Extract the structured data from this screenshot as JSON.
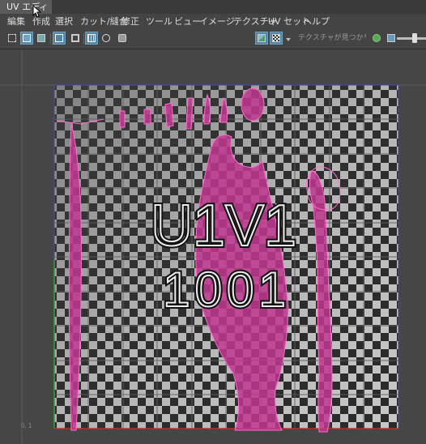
{
  "window": {
    "tab_title": "UV エディタ"
  },
  "menus": [
    "編集",
    "作成",
    "選択",
    "カット/縫合",
    "修正",
    "ツール",
    "ビュー",
    "イメージ",
    "テクスチャ",
    "UV セット",
    "ヘルプ"
  ],
  "toolbar": {
    "search_placeholder": "テクスチャが見つかり...",
    "icons": [
      "grid-icon",
      "uv-shell-icon",
      "uv-shell-icon",
      "frame-icon",
      "frame-selected-icon",
      "grid-toggle-icon",
      "checker-icon",
      "snapshot-icon",
      "image-icon",
      "checker-display-icon",
      "dropdown-arrow-icon",
      "exposure-icon",
      "gamma-icon"
    ]
  },
  "viewport": {
    "tile_label_line1": "U1V1",
    "tile_label_line2": "1001",
    "axis_label": "0, 1",
    "colors": {
      "uv_shell": "#c0378f",
      "shell_edge": "#ff6fd0",
      "checker_light": "#c8c8c8",
      "checker_dark": "#1a1a1a",
      "grid": "#6a6a6a",
      "u_axis": "#b53030",
      "v_axis": "#3d9c3d"
    }
  }
}
